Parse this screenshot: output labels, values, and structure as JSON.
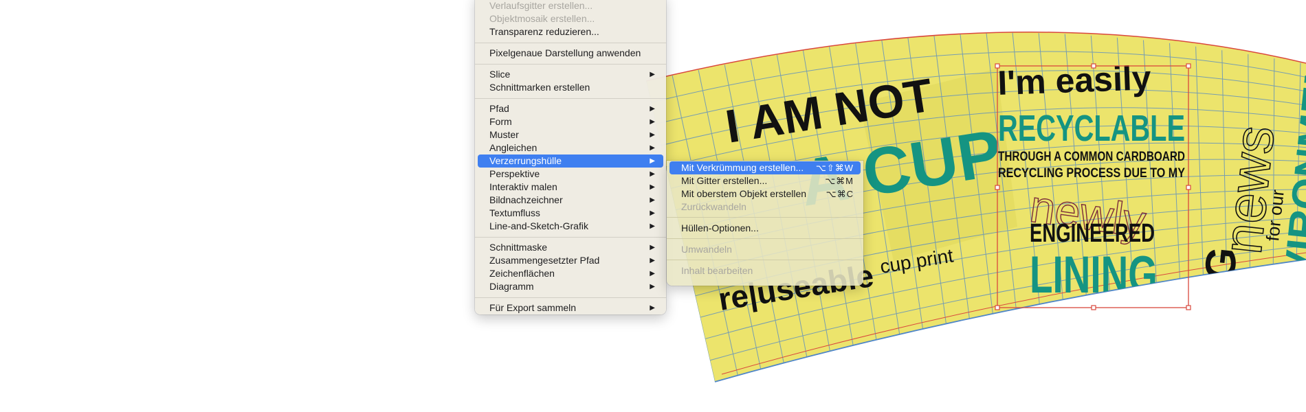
{
  "menu": {
    "items": [
      {
        "label": "Verlaufsgitter erstellen...",
        "disabled": true
      },
      {
        "label": "Objektmosaik erstellen...",
        "disabled": true
      },
      {
        "label": "Transparenz reduzieren..."
      },
      {
        "label": "Pixelgenaue Darstellung anwenden"
      },
      {
        "label": "Slice",
        "submenu": true
      },
      {
        "label": "Schnittmarken erstellen"
      },
      {
        "label": "Pfad",
        "submenu": true
      },
      {
        "label": "Form",
        "submenu": true
      },
      {
        "label": "Muster",
        "submenu": true
      },
      {
        "label": "Angleichen",
        "submenu": true
      },
      {
        "label": "Verzerrungshülle",
        "submenu": true,
        "highlighted": true
      },
      {
        "label": "Perspektive",
        "submenu": true
      },
      {
        "label": "Interaktiv malen",
        "submenu": true
      },
      {
        "label": "Bildnachzeichner",
        "submenu": true
      },
      {
        "label": "Textumfluss",
        "submenu": true
      },
      {
        "label": "Line-and-Sketch-Grafik",
        "submenu": true
      },
      {
        "label": "Schnittmaske",
        "submenu": true
      },
      {
        "label": "Zusammengesetzter Pfad",
        "submenu": true
      },
      {
        "label": "Zeichenflächen",
        "submenu": true
      },
      {
        "label": "Diagramm",
        "submenu": true
      },
      {
        "label": "Für Export sammeln",
        "submenu": true
      }
    ],
    "arrow_glyph": "▶"
  },
  "submenu": {
    "items": [
      {
        "label": "Mit Verkrümmung erstellen...",
        "shortcut": "⌥⇧⌘W",
        "highlighted": true
      },
      {
        "label": "Mit Gitter erstellen...",
        "shortcut": "⌥⌘M"
      },
      {
        "label": "Mit oberstem Objekt erstellen",
        "shortcut": "⌥⌘C"
      },
      {
        "label": "Zurückwandeln",
        "disabled": true
      },
      {
        "label": "Hüllen-Optionen..."
      },
      {
        "label": "Umwandeln",
        "disabled": true
      },
      {
        "label": "Inhalt bearbeiten",
        "disabled": true
      }
    ]
  },
  "artwork": {
    "line1": "I AM NOT",
    "line2": "A CUP",
    "brand_prefix": "re|useable",
    "brand_suffix": "cup print",
    "easily": "I'm easily",
    "recyclable": "RECYCLABLE",
    "through": "THROUGH A COMMON CARDBOARD",
    "recycling": "RECYCLING PROCESS DUE TO MY",
    "newly": "newly",
    "engineered": "ENGINEERED",
    "lining": "LINING",
    "big": "BIG",
    "news": "news",
    "for_our": "for our",
    "environment": "ENVIRONMENT"
  },
  "colors": {
    "accent": "#3f7ff0",
    "artwork_yellow": "#ece46c",
    "teal": "#159482",
    "grid_blue": "#4f86c8",
    "selection_red": "#d9473c"
  }
}
